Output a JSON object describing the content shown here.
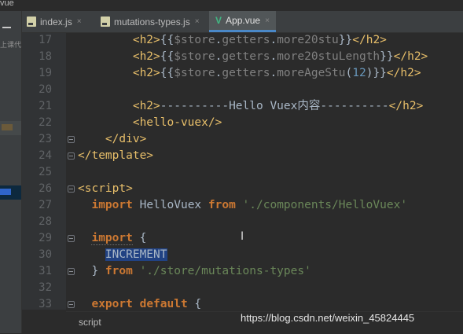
{
  "window": {
    "corner_label": "vue"
  },
  "left_panel": {
    "text": "上课代"
  },
  "tabs": [
    {
      "label": "index.js",
      "close": "×"
    },
    {
      "label": "mutations-types.js",
      "close": "×"
    },
    {
      "label": "App.vue",
      "close": "×",
      "icon": "V"
    }
  ],
  "lines": [
    {
      "n": "17",
      "seg": [
        {
          "t": "        "
        },
        {
          "t": "<h2>",
          "c": "tag"
        },
        {
          "t": "{{"
        },
        {
          "t": "$store",
          "c": "gray"
        },
        {
          "t": "."
        },
        {
          "t": "getters",
          "c": "gray"
        },
        {
          "t": "."
        },
        {
          "t": "more20stu",
          "c": "gray"
        },
        {
          "t": "}}"
        },
        {
          "t": "</h2>",
          "c": "tag"
        }
      ]
    },
    {
      "n": "18",
      "seg": [
        {
          "t": "        "
        },
        {
          "t": "<h2>",
          "c": "tag"
        },
        {
          "t": "{{"
        },
        {
          "t": "$store",
          "c": "gray"
        },
        {
          "t": "."
        },
        {
          "t": "getters",
          "c": "gray"
        },
        {
          "t": "."
        },
        {
          "t": "more20stuLength",
          "c": "gray"
        },
        {
          "t": "}}"
        },
        {
          "t": "</h2>",
          "c": "tag"
        }
      ]
    },
    {
      "n": "19",
      "seg": [
        {
          "t": "        "
        },
        {
          "t": "<h2>",
          "c": "tag"
        },
        {
          "t": "{{"
        },
        {
          "t": "$store",
          "c": "gray"
        },
        {
          "t": "."
        },
        {
          "t": "getters",
          "c": "gray"
        },
        {
          "t": "."
        },
        {
          "t": "moreAgeStu",
          "c": "gray"
        },
        {
          "t": "("
        },
        {
          "t": "12",
          "c": "num"
        },
        {
          "t": ")}}"
        },
        {
          "t": "</h2>",
          "c": "tag"
        }
      ]
    },
    {
      "n": "20",
      "seg": []
    },
    {
      "n": "21",
      "seg": [
        {
          "t": "        "
        },
        {
          "t": "<h2>",
          "c": "tag"
        },
        {
          "t": "----------Hello Vuex内容----------"
        },
        {
          "t": "</h2>",
          "c": "tag"
        }
      ]
    },
    {
      "n": "22",
      "seg": [
        {
          "t": "        "
        },
        {
          "t": "<hello-vuex/>",
          "c": "tag"
        }
      ]
    },
    {
      "n": "23",
      "seg": [
        {
          "t": "    "
        },
        {
          "t": "</div>",
          "c": "tag"
        }
      ]
    },
    {
      "n": "24",
      "seg": [
        {
          "t": "</template>",
          "c": "tag"
        }
      ]
    },
    {
      "n": "25",
      "seg": []
    },
    {
      "n": "26",
      "seg": [
        {
          "t": "<script>",
          "c": "tag"
        }
      ]
    },
    {
      "n": "27",
      "seg": [
        {
          "t": "  "
        },
        {
          "t": "import",
          "c": "kw"
        },
        {
          "t": " HelloVuex "
        },
        {
          "t": "from",
          "c": "kw"
        },
        {
          "t": " "
        },
        {
          "t": "'./components/HelloVuex'",
          "c": "str"
        }
      ]
    },
    {
      "n": "28",
      "seg": []
    },
    {
      "n": "29",
      "seg": [
        {
          "t": "  "
        },
        {
          "t": "import",
          "c": "kw squig"
        },
        {
          "t": " {"
        }
      ]
    },
    {
      "n": "30",
      "seg": [
        {
          "t": "    "
        },
        {
          "t": "INCREMENT",
          "c": "hl"
        }
      ]
    },
    {
      "n": "31",
      "seg": [
        {
          "t": "  } "
        },
        {
          "t": "from",
          "c": "kw"
        },
        {
          "t": " "
        },
        {
          "t": "'./store/mutations-types'",
          "c": "str"
        }
      ]
    },
    {
      "n": "32",
      "seg": []
    },
    {
      "n": "33",
      "seg": [
        {
          "t": "  "
        },
        {
          "t": "export",
          "c": "kw"
        },
        {
          "t": " "
        },
        {
          "t": "default",
          "c": "kw"
        },
        {
          "t": " {"
        }
      ]
    }
  ],
  "breadcrumb": "script",
  "watermark": "https://blog.csdn.net/weixin_45824445",
  "colors": {
    "tag": "#e8bf6a",
    "keyword": "#cc7832",
    "string": "#6a8759",
    "number": "#6897bb",
    "selection": "#214283"
  }
}
